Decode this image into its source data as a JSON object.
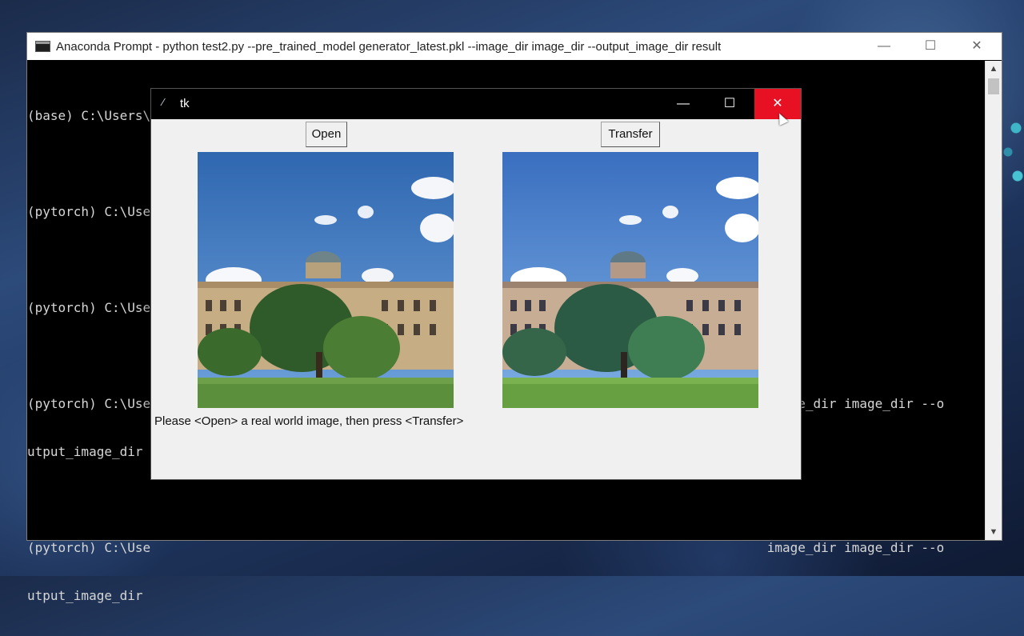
{
  "console": {
    "title": "Anaconda Prompt - python  test2.py --pre_trained_model generator_latest.pkl --image_dir image_dir --output_image_dir result",
    "lines": [
      "(base) C:\\Users\\LOF>conda activate pytorch",
      "",
      "(pytorch) C:\\Use",
      "",
      "(pytorch) C:\\Use",
      "",
      "(pytorch) C:\\Use                                                                                image_dir image_dir --o",
      "utput_image_dir",
      "",
      "(pytorch) C:\\Use                                                                                image_dir image_dir --o",
      "utput_image_dir"
    ],
    "controls": {
      "minimize": "—",
      "maximize": "☐",
      "close": "✕"
    }
  },
  "tk": {
    "title": "tk",
    "open_label": "Open",
    "transfer_label": "Transfer",
    "status": "Please <Open> a real world image, then press <Transfer>",
    "controls": {
      "minimize": "—",
      "maximize": "☐",
      "close": "✕"
    }
  },
  "colors": {
    "close_red": "#e81123",
    "sky_left": "#2f67b0",
    "sky_right": "#3a6fc0",
    "grass": "#6ea04a"
  }
}
